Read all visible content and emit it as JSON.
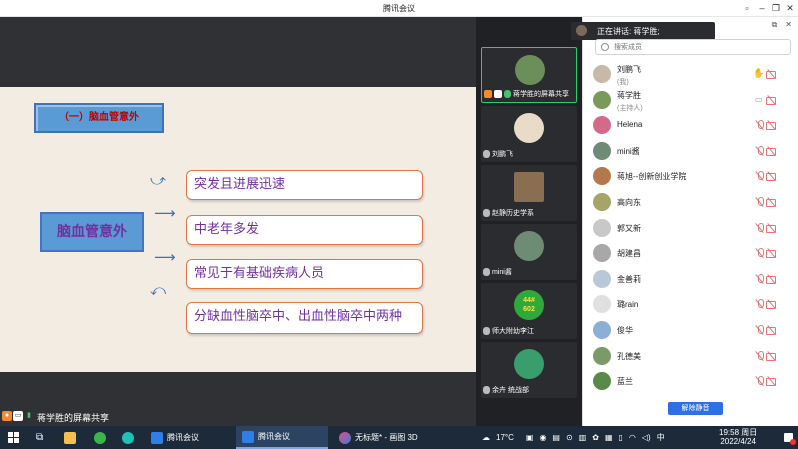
{
  "window": {
    "title": "腾讯会议"
  },
  "share": {
    "presenter_label": "蒋学胜的屏幕共享",
    "slide": {
      "heading": "（一）脑血管意外",
      "main": "脑血管意外",
      "points": [
        "突发且进展迅速",
        "中老年多发",
        "常见于有基础疾病人员",
        "分缺血性脑卒中、出血性脑卒中两种"
      ]
    }
  },
  "video_tiles": [
    {
      "name": "蒋学胜的屏幕共享",
      "avatar_color": "#6b8e5a",
      "active": true
    },
    {
      "name": "刘鹏飞",
      "avatar_color": "#e8dcc8"
    },
    {
      "name": "赵静历史学系",
      "avatar_color": "#8a6e52"
    },
    {
      "name": "mini酱",
      "avatar_color": "#6e8b74"
    },
    {
      "name": "师大附幼李江",
      "avatar_color": "#2eaa3a",
      "avatar_text": "44#\n602"
    },
    {
      "name": "余卉 统战部",
      "avatar_color": "#3a9e6c"
    }
  ],
  "panel": {
    "speaking": "正在讲话: 蒋学胜;",
    "search_placeholder": "搜索成员",
    "participants": [
      {
        "name": "刘鹏飞",
        "sub": "(我)",
        "color": "#c8b8a8"
      },
      {
        "name": "蒋学胜",
        "sub": "(主持人)",
        "color": "#7a9a5a"
      },
      {
        "name": "Helena",
        "color": "#d46a8a"
      },
      {
        "name": "mini酱",
        "color": "#6e8b74"
      },
      {
        "name": "蒋旭--创新创业学院",
        "color": "#b5784a"
      },
      {
        "name": "高向东",
        "color": "#a5a56a"
      },
      {
        "name": "郭又新",
        "color": "#c8c8c8"
      },
      {
        "name": "胡建昌",
        "color": "#a8a8a8"
      },
      {
        "name": "金善莉",
        "color": "#b8c8d8"
      },
      {
        "name": "璐rain",
        "color": "#e0e0e0"
      },
      {
        "name": "俊华",
        "color": "#8ab0d8"
      },
      {
        "name": "孔德美",
        "color": "#7a9a6a"
      },
      {
        "name": "蓝兰",
        "color": "#5a8a4a"
      }
    ],
    "mute_all": "解除静音"
  },
  "taskbar": {
    "apps": [
      "腾讯会议",
      "腾讯会议",
      "无标题* - 画图 3D"
    ],
    "weather": "17°C",
    "ime": "中",
    "time": "19:58 周日",
    "date": "2022/4/24"
  }
}
